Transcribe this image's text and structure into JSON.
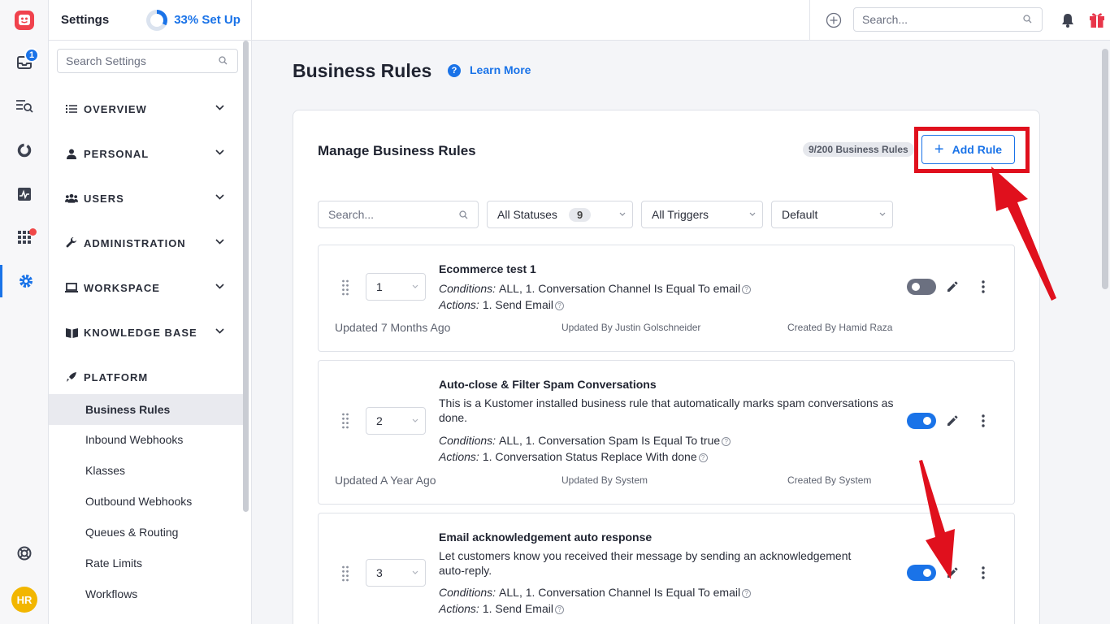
{
  "rail": {
    "inbox_badge": "1",
    "avatar_initials": "HR"
  },
  "sidebar": {
    "title": "Settings",
    "setup_label": "33% Set Up",
    "setup_progress": 0.33,
    "search_placeholder": "Search Settings",
    "sections": [
      {
        "label": "OVERVIEW",
        "icon": "list-icon"
      },
      {
        "label": "PERSONAL",
        "icon": "person-icon"
      },
      {
        "label": "USERS",
        "icon": "users-icon"
      },
      {
        "label": "ADMINISTRATION",
        "icon": "wrench-icon"
      },
      {
        "label": "WORKSPACE",
        "icon": "laptop-icon"
      },
      {
        "label": "KNOWLEDGE BASE",
        "icon": "book-icon"
      },
      {
        "label": "PLATFORM",
        "icon": "rocket-icon"
      }
    ],
    "platform_items": [
      "Business Rules",
      "Inbound Webhooks",
      "Klasses",
      "Outbound Webhooks",
      "Queues & Routing",
      "Rate Limits",
      "Workflows"
    ]
  },
  "topbar": {
    "search_placeholder": "Search..."
  },
  "main": {
    "title": "Business Rules",
    "learn_more": "Learn More",
    "card_title": "Manage Business Rules",
    "count_badge": "9/200 Business Rules",
    "add_rule_label": "Add Rule",
    "filters": {
      "search_placeholder": "Search...",
      "status": "All Statuses",
      "status_count": "9",
      "triggers": "All Triggers",
      "sort": "Default"
    },
    "rules": [
      {
        "order": "1",
        "name": "Ecommerce test 1",
        "description": "",
        "conditions_label": "Conditions:",
        "conditions": "ALL, 1. Conversation Channel Is Equal To email",
        "actions_label": "Actions:",
        "actions": "1. Send Email",
        "updated": "Updated 7 Months Ago",
        "updated_by": "Updated By Justin Golschneider",
        "created_by": "Created By Hamid Raza",
        "enabled": false
      },
      {
        "order": "2",
        "name": "Auto-close & Filter Spam Conversations",
        "description": "This is a Kustomer installed business rule that automatically marks spam conversations as done.",
        "conditions_label": "Conditions:",
        "conditions": "ALL, 1. Conversation Spam Is Equal To true",
        "actions_label": "Actions:",
        "actions": "1. Conversation Status Replace With done",
        "updated": "Updated A Year Ago",
        "updated_by": "Updated By System",
        "created_by": "Created By System",
        "enabled": true
      },
      {
        "order": "3",
        "name": "Email acknowledgement auto response",
        "description": "Let customers know you received their message by sending an acknowledgement auto-reply.",
        "conditions_label": "Conditions:",
        "conditions": "ALL, 1. Conversation Channel Is Equal To email",
        "actions_label": "Actions:",
        "actions": "1. Send Email",
        "enabled": true
      }
    ]
  },
  "colors": {
    "accent": "#1a73e8",
    "annotation_red": "#e0101d",
    "toggle_off": "#6b7080"
  }
}
